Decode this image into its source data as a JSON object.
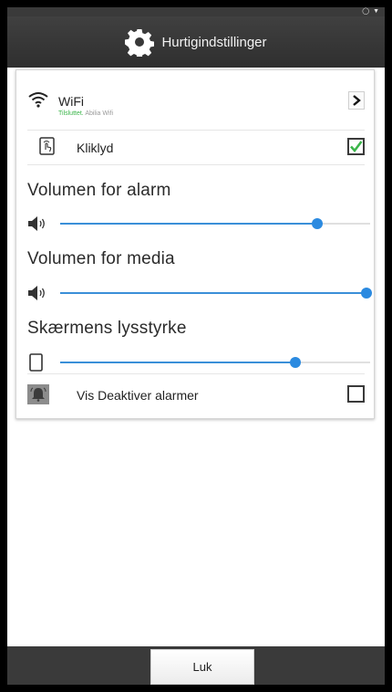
{
  "header": {
    "title": "Hurtigindstillinger",
    "icon": "gear-icon"
  },
  "wifi": {
    "label": "WiFi",
    "status": "Tilsluttet.",
    "network": "Abilia Wifi"
  },
  "click_sound": {
    "label": "Kliklyd",
    "checked": true
  },
  "alarm_volume": {
    "title": "Volumen for alarm",
    "value_fraction": 0.83
  },
  "media_volume": {
    "title": "Volumen for media",
    "value_fraction": 1.0
  },
  "brightness": {
    "title": "Skærmens lysstyrke",
    "value_fraction": 0.76
  },
  "disable_alarms": {
    "label": "Vis Deaktiver alarmer",
    "checked": false
  },
  "footer": {
    "close_label": "Luk"
  },
  "colors": {
    "accent": "#2b8ae0",
    "check_green": "#3bb54a",
    "bar": "#3a3a3a"
  }
}
